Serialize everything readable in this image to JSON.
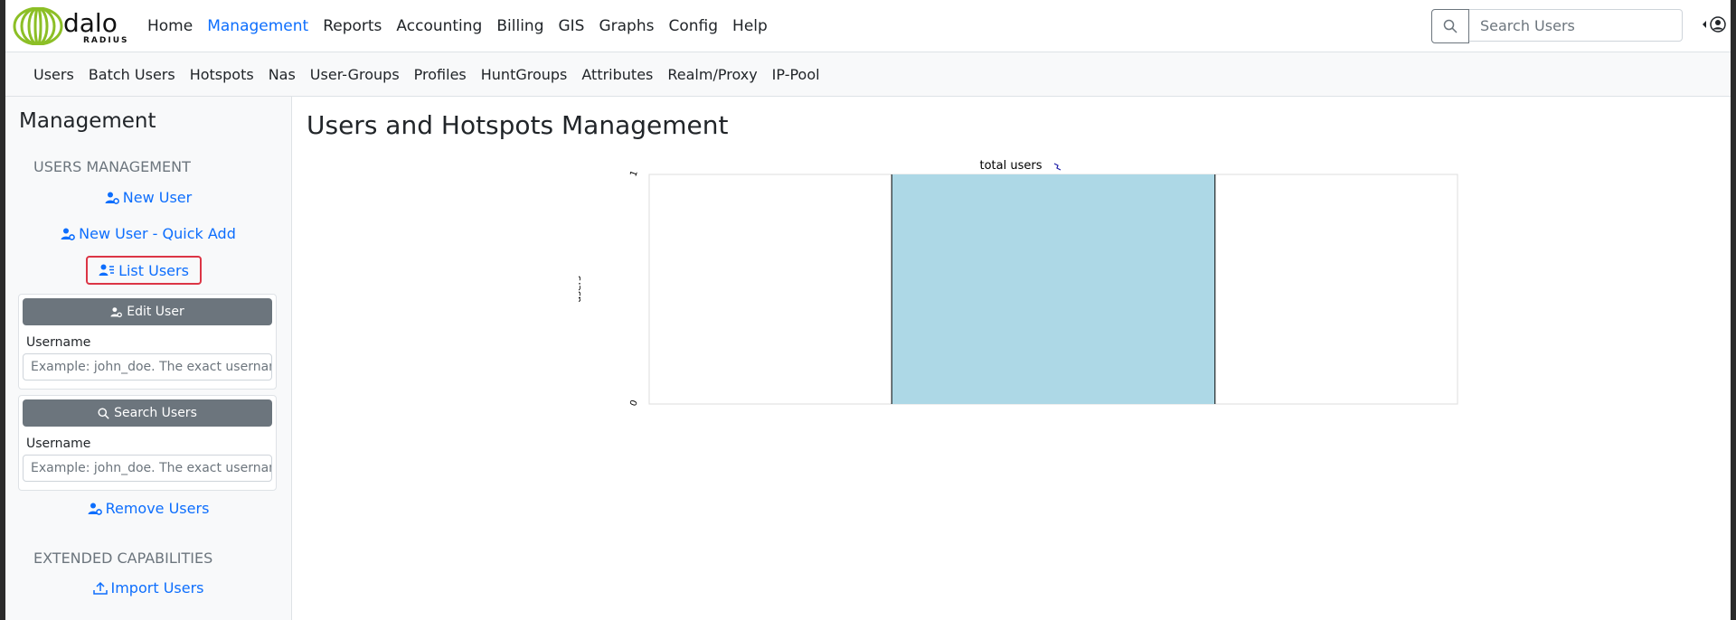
{
  "brand": {
    "logo_text": "dalo",
    "logo_subtext": "RADIUS"
  },
  "nav": {
    "items": [
      {
        "label": "Home",
        "active": false
      },
      {
        "label": "Management",
        "active": true
      },
      {
        "label": "Reports",
        "active": false
      },
      {
        "label": "Accounting",
        "active": false
      },
      {
        "label": "Billing",
        "active": false
      },
      {
        "label": "GIS",
        "active": false
      },
      {
        "label": "Graphs",
        "active": false
      },
      {
        "label": "Config",
        "active": false
      },
      {
        "label": "Help",
        "active": false
      }
    ],
    "search_placeholder": "Search Users",
    "accent_color": "#0d6efd"
  },
  "subnav": {
    "items": [
      "Users",
      "Batch Users",
      "Hotspots",
      "Nas",
      "User-Groups",
      "Profiles",
      "HuntGroups",
      "Attributes",
      "Realm/Proxy",
      "IP-Pool"
    ]
  },
  "sidebar": {
    "title": "Management",
    "section_users": "USERS MANAGEMENT",
    "new_user": "New User",
    "new_user_quick": "New User - Quick Add",
    "list_users": "List Users",
    "edit_user_button": "Edit User",
    "edit_username_label": "Username",
    "edit_username_placeholder": "Example: john_doe. The exact username to edit",
    "search_users_button": "Search Users",
    "search_username_label": "Username",
    "search_username_placeholder": "Example: john_doe. The exact username to search",
    "remove_users": "Remove Users",
    "section_extended": "EXTENDED CAPABILITIES",
    "import_users": "Import Users"
  },
  "main": {
    "title": "Users and Hotspots Management"
  },
  "chart_data": {
    "type": "bar",
    "title": "total users",
    "categories": [
      ""
    ],
    "values": [
      1
    ],
    "ylabel": "users",
    "xlabel": "",
    "ylim": [
      0,
      1
    ],
    "yticks": [
      "0",
      "1"
    ],
    "bar_color": "#add8e6",
    "grid": false
  }
}
